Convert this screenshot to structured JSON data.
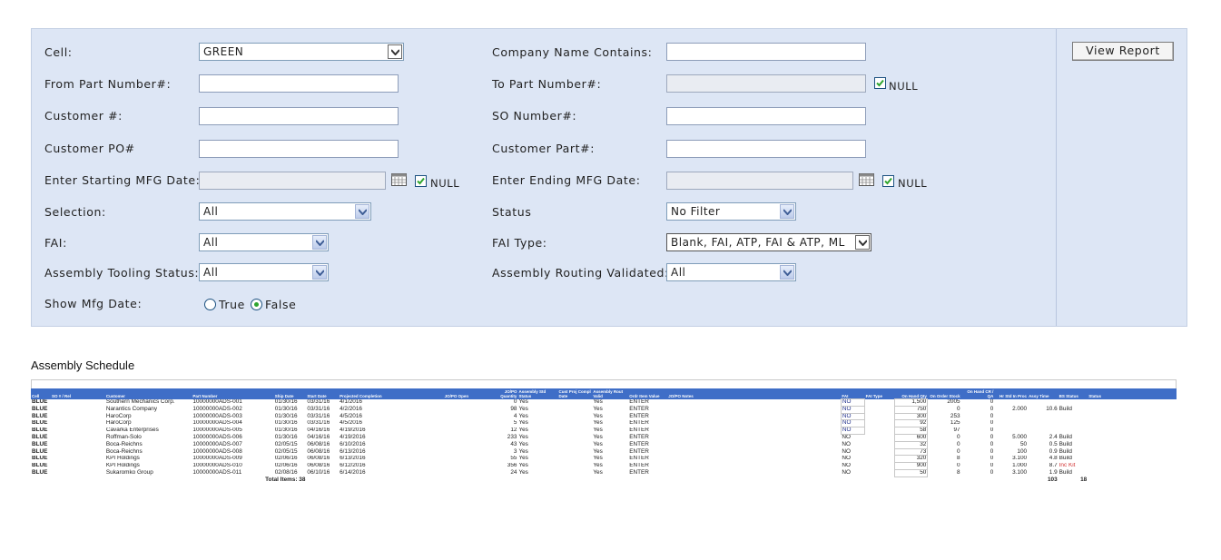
{
  "filters": {
    "cell": {
      "label": "Cell:",
      "value": "GREEN"
    },
    "company_name": {
      "label": "Company Name Contains:",
      "value": ""
    },
    "from_part": {
      "label": "From Part Number#:",
      "value": ""
    },
    "to_part": {
      "label": "To Part Number#:",
      "value": "",
      "null_label": "NULL",
      "null_checked": true
    },
    "customer_no": {
      "label": "Customer #:",
      "value": ""
    },
    "so_number": {
      "label": "SO Number#:",
      "value": ""
    },
    "customer_po": {
      "label": "Customer PO#",
      "value": ""
    },
    "customer_part": {
      "label": "Customer Part#:",
      "value": ""
    },
    "start_mfg_date": {
      "label": "Enter Starting MFG Date:",
      "value": "",
      "null_label": "NULL",
      "null_checked": true
    },
    "end_mfg_date": {
      "label": "Enter Ending MFG Date:",
      "value": "",
      "null_label": "NULL",
      "null_checked": true
    },
    "selection": {
      "label": "Selection:",
      "value": "All"
    },
    "status": {
      "label": "Status",
      "value": "No Filter"
    },
    "fai": {
      "label": "FAI:",
      "value": "All"
    },
    "fai_type": {
      "label": "FAI Type:",
      "value": "Blank, FAI, ATP, FAI & ATP, ML"
    },
    "assembly_tooling_status": {
      "label": "Assembly Tooling Status:",
      "value": "All"
    },
    "assembly_routing_validated": {
      "label": "Assembly Routing Validated:",
      "value": "All"
    },
    "show_mfg_date": {
      "label": "Show Mfg Date:",
      "true_label": "True",
      "false_label": "False",
      "selected": "False"
    }
  },
  "view_report_label": "View Report",
  "report": {
    "title": "Assembly Schedule",
    "columns": [
      "Cell",
      "SO # / Rel",
      "Customer",
      "Part Number",
      "Ship Date",
      "Start Date",
      "Projected Completion",
      "JO/PO Open",
      "JO/PO Quantity",
      "Assembly Std Status",
      "Cust Proj Compl Date",
      "Assembly Rout Valid",
      "Ordr Item Value",
      "JO/PO Notes",
      "FAI",
      "FAI Type",
      "On Hand Qty",
      "On Order Stock",
      "On Hand CR / QA",
      "Hr Std In Proc",
      "Assy Time",
      "BS Status",
      "Status"
    ],
    "rows": [
      [
        "BLUE",
        "",
        "Southern Mechanics Corp.",
        "10000000ADS-001",
        "01/30/16",
        "03/31/16",
        "4/1/2016",
        "",
        "0",
        "Yes",
        "",
        "Yes",
        "ENTER",
        "",
        "NO",
        "",
        "1,500",
        "2005",
        "0",
        "",
        "",
        "",
        ""
      ],
      [
        "BLUE",
        "",
        "Narantics Company",
        "10000000ADS-002",
        "01/30/16",
        "03/31/16",
        "4/2/2016",
        "",
        "98",
        "Yes",
        "",
        "Yes",
        "ENTER",
        "",
        "NO",
        "",
        "750",
        "0",
        "0",
        "2.000",
        "10.6",
        "Build",
        ""
      ],
      [
        "BLUE",
        "",
        "HaroCorp",
        "10000000ADS-003",
        "01/30/16",
        "03/31/16",
        "4/5/2016",
        "",
        "4",
        "Yes",
        "",
        "Yes",
        "ENTER",
        "",
        "NO",
        "",
        "300",
        "253",
        "0",
        "",
        "",
        "",
        ""
      ],
      [
        "BLUE",
        "",
        "HaroCorp",
        "10000000ADS-004",
        "01/30/16",
        "03/31/16",
        "4/5/2016",
        "",
        "5",
        "Yes",
        "",
        "Yes",
        "ENTER",
        "",
        "NO",
        "",
        "92",
        "125",
        "0",
        "",
        "",
        "",
        ""
      ],
      [
        "BLUE",
        "",
        "Cavarka Enterprises",
        "10000000ADS-005",
        "01/30/16",
        "04/16/16",
        "4/19/2016",
        "",
        "12",
        "Yes",
        "",
        "Yes",
        "ENTER",
        "",
        "NO",
        "",
        "58",
        "97",
        "0",
        "",
        "",
        "",
        ""
      ],
      [
        "BLUE",
        "",
        "Roffman-Solo",
        "10000000ADS-006",
        "01/30/16",
        "04/16/16",
        "4/19/2016",
        "",
        "233",
        "Yes",
        "",
        "Yes",
        "ENTER",
        "",
        "NO",
        "",
        "600",
        "0",
        "0",
        "5.000",
        "2.4",
        "Build",
        ""
      ],
      [
        "BLUE",
        "",
        "Boca-Reichns",
        "10000000ADS-007",
        "02/05/15",
        "06/08/16",
        "6/10/2016",
        "",
        "43",
        "Yes",
        "",
        "Yes",
        "ENTER",
        "",
        "NO",
        "",
        "32",
        "0",
        "0",
        "50",
        "0.5",
        "Build",
        ""
      ],
      [
        "BLUE",
        "",
        "Boca-Reichns",
        "10000000ADS-008",
        "02/05/15",
        "06/08/16",
        "6/13/2016",
        "",
        "3",
        "Yes",
        "",
        "Yes",
        "ENTER",
        "",
        "NO",
        "",
        "73",
        "0",
        "0",
        "100",
        "0.9",
        "Build",
        ""
      ],
      [
        "BLUE",
        "",
        "KPI Holdings",
        "10000000ADS-009",
        "02/06/16",
        "06/08/16",
        "6/13/2016",
        "",
        "55",
        "Yes",
        "",
        "Yes",
        "ENTER",
        "",
        "NO",
        "",
        "320",
        "8",
        "0",
        "3.100",
        "4.8",
        "Build",
        ""
      ],
      [
        "BLUE",
        "",
        "KPI Holdings",
        "10000000ADS-010",
        "02/06/16",
        "06/08/16",
        "6/12/2016",
        "",
        "356",
        "Yes",
        "",
        "Yes",
        "ENTER",
        "",
        "NO",
        "",
        "900",
        "0",
        "0",
        "1.000",
        "8.7",
        "Inc Kit",
        ""
      ],
      [
        "BLUE",
        "",
        "Sukaromko Group",
        "10000000ADS-011",
        "02/08/16",
        "06/10/16",
        "6/14/2016",
        "",
        "24",
        "Yes",
        "",
        "Yes",
        "ENTER",
        "",
        "NO",
        "",
        "50",
        "8",
        "0",
        "3.100",
        "1.9",
        "Build",
        ""
      ]
    ],
    "total_label": "Total Items: 38",
    "total_assy_time": "103",
    "total_bs_status": "18"
  },
  "colors": {
    "panel_bg": "#dde6f5",
    "header_bg": "#3f6ec7",
    "inc_kit": "#d23131"
  }
}
